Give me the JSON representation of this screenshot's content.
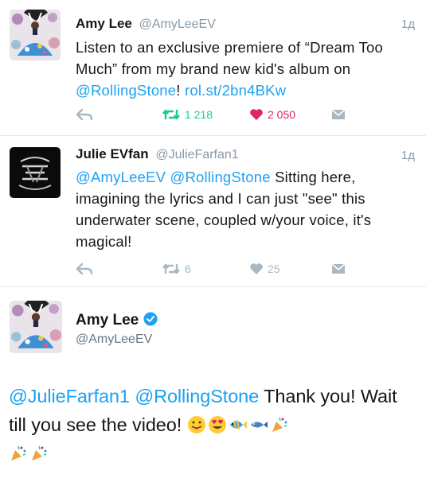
{
  "tweets": [
    {
      "name": "Amy Lee",
      "handle": "@AmyLeeEV",
      "time": "1д",
      "text_1": "Listen to an exclusive premiere of “Dream Too Much” from my brand new kid's album on ",
      "mention": "@RollingStone",
      "text_2": "! ",
      "link": "rol.st/2bn4BKw",
      "retweets": "1 218",
      "likes": "2 050"
    },
    {
      "name": "Julie EVfan",
      "handle": "@JulieFarfan1",
      "time": "1д",
      "mention_1": "@AmyLeeEV",
      "mention_2": "@RollingStone",
      "text": " Sitting here, imagining the lyrics and I can just \"see\" this underwater scene, coupled w/your voice, it's magical!",
      "retweets": "6",
      "likes": "25"
    }
  ],
  "focused": {
    "name": "Amy Lee",
    "handle": "@AmyLeeEV",
    "mention_1": "@JulieFarfan1",
    "mention_2": "@RollingStone",
    "text": " Thank you! Wait till you see the video! "
  },
  "colors": {
    "link": "#1da1f2",
    "retweet_active": "#19cf86",
    "like_active": "#e0245e",
    "muted": "#aab8c2"
  }
}
